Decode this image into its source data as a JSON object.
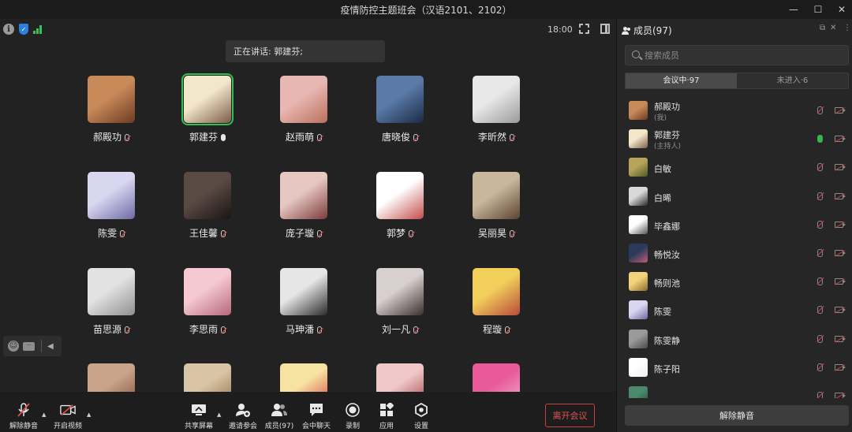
{
  "window": {
    "title": "疫情防控主题班会（汉语2101、2102）",
    "min": "—",
    "max": "☐",
    "close": "✕"
  },
  "status": {
    "time": "18:00",
    "info_glyph": "i"
  },
  "speaking_text": "正在讲话: 郭建芬;",
  "tiles": [
    {
      "name": "郝殿功",
      "colors": [
        "#c98a5a",
        "#6b3b20"
      ],
      "muted": true
    },
    {
      "name": "郭建芬",
      "colors": [
        "#f3e7c9",
        "#7b5d4b"
      ],
      "muted": false,
      "active": true
    },
    {
      "name": "赵雨萌",
      "colors": [
        "#e9b7b3",
        "#b8705b"
      ],
      "muted": true
    },
    {
      "name": "唐晓俊",
      "colors": [
        "#5a7aa8",
        "#1c2a45"
      ],
      "muted": true
    },
    {
      "name": "李昕然",
      "colors": [
        "#e8e8e8",
        "#9a9a9a"
      ],
      "muted": true
    },
    {
      "name": "陈雯",
      "colors": [
        "#d9d6f0",
        "#6d6aa3"
      ],
      "muted": true
    },
    {
      "name": "王佳馨",
      "colors": [
        "#5a4a44",
        "#1a1414"
      ],
      "muted": true
    },
    {
      "name": "庞子璇",
      "colors": [
        "#e7c7c2",
        "#7a3c3c"
      ],
      "muted": true
    },
    {
      "name": "郭梦",
      "colors": [
        "#ffffff",
        "#c44b4b"
      ],
      "muted": true
    },
    {
      "name": "吴丽昊",
      "colors": [
        "#c9b79b",
        "#5a4332"
      ],
      "muted": true
    },
    {
      "name": "苗思源",
      "colors": [
        "#e2e2e2",
        "#8f8f8f"
      ],
      "muted": true
    },
    {
      "name": "李思雨",
      "colors": [
        "#f5c9d1",
        "#b7677b"
      ],
      "muted": true
    },
    {
      "name": "马珅潘",
      "colors": [
        "#e6e6e6",
        "#2a2a2a"
      ],
      "muted": true
    },
    {
      "name": "刘一凡",
      "colors": [
        "#d8cfcf",
        "#3b2f2f"
      ],
      "muted": true
    },
    {
      "name": "程璇",
      "colors": [
        "#f2cf5b",
        "#b84a3a"
      ],
      "muted": true
    },
    {
      "name": "",
      "colors": [
        "#c9a38a",
        "#7a4a36"
      ],
      "muted": true
    },
    {
      "name": "",
      "colors": [
        "#d9c5a5",
        "#8a6a45"
      ],
      "muted": true
    },
    {
      "name": "",
      "colors": [
        "#f6e3a1",
        "#d13a3a"
      ],
      "muted": true
    },
    {
      "name": "",
      "colors": [
        "#f0c8c8",
        "#9a3a3a"
      ],
      "muted": true
    },
    {
      "name": "",
      "colors": [
        "#e85a9a",
        "#f3b3cf"
      ],
      "muted": true
    }
  ],
  "toolbar": {
    "unmute": "解除静音",
    "start_video": "开启视频",
    "share": "共享屏幕",
    "invite": "邀请参会",
    "members": "成员(97)",
    "chat": "会中聊天",
    "record": "录制",
    "apps": "应用",
    "settings": "设置",
    "leave": "离开会议"
  },
  "panel": {
    "title": "成员(97)",
    "search_placeholder": "搜索成员",
    "tab_in": "会议中·97",
    "tab_out": "未进入·6",
    "unmute_all": "解除静音",
    "members": [
      {
        "name": "郝殿功",
        "sub": "(我)",
        "mic": "muted",
        "colors": [
          "#c98a5a",
          "#6b3b20"
        ]
      },
      {
        "name": "郭建芬",
        "sub": "(主持人)",
        "mic": "on",
        "colors": [
          "#f3e7c9",
          "#7b5d4b"
        ]
      },
      {
        "name": "白敏",
        "sub": "",
        "mic": "muted",
        "colors": [
          "#b8a35a",
          "#4a5a2a"
        ]
      },
      {
        "name": "白晞",
        "sub": "",
        "mic": "muted",
        "colors": [
          "#d9d9d9",
          "#2a2a2a"
        ]
      },
      {
        "name": "毕鑫娜",
        "sub": "",
        "mic": "muted",
        "colors": [
          "#ffffff",
          "#555555"
        ]
      },
      {
        "name": "畅悦汝",
        "sub": "",
        "mic": "muted",
        "colors": [
          "#2a3a5a",
          "#c45a7a"
        ]
      },
      {
        "name": "畅则池",
        "sub": "",
        "mic": "muted",
        "colors": [
          "#f3d27a",
          "#8a6a2a"
        ]
      },
      {
        "name": "陈雯",
        "sub": "",
        "mic": "muted",
        "colors": [
          "#d9d6f0",
          "#6d6aa3"
        ]
      },
      {
        "name": "陈雯静",
        "sub": "",
        "mic": "muted",
        "colors": [
          "#9a9a9a",
          "#4a4a4a"
        ]
      },
      {
        "name": "陈子阳",
        "sub": "",
        "mic": "muted",
        "colors": [
          "#ffffff",
          "#eeeeee"
        ]
      },
      {
        "name": "",
        "sub": "",
        "mic": "muted",
        "colors": [
          "#4a8a6a",
          "#2a4a3a"
        ]
      }
    ]
  }
}
